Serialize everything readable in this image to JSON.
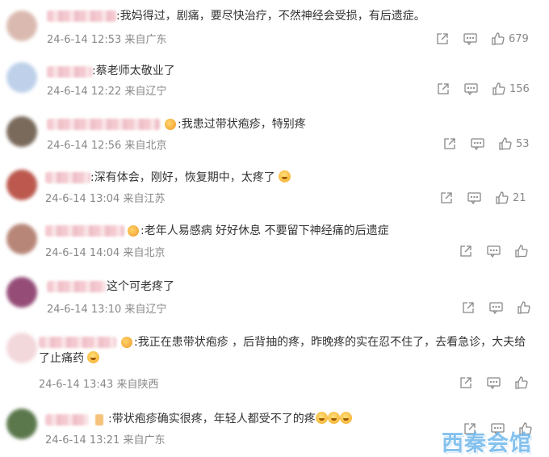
{
  "comments": [
    {
      "text": ":我妈得过，剧痛，要尽快治疗，不然神经会受损，有后遗症。",
      "time": "24-6-14 12:53",
      "location": "来自广东",
      "likes": "679",
      "avatar_color": "#d7b3a8"
    },
    {
      "text": ":蔡老师太敬业了",
      "time": "24-6-14 12:22",
      "location": "来自辽宁",
      "likes": "156",
      "avatar_color": "#b7cce8"
    },
    {
      "text": ":我患过带状疱疹，特别疼",
      "time": "24-6-14 12:56",
      "location": "来自北京",
      "likes": "53",
      "avatar_color": "#6b5a4a"
    },
    {
      "text": ":深有体会，刚好，恢复期中，太疼了",
      "time": "24-6-14 13:04",
      "location": "来自江苏",
      "likes": "21",
      "avatar_color": "#b5473b"
    },
    {
      "text": ":老年人易感病 好好休息 不要留下神经痛的后遗症",
      "time": "24-6-14 14:04",
      "location": "来自北京",
      "likes": "",
      "avatar_color": "#b07a6a"
    },
    {
      "text": "这个可老疼了",
      "time": "24-6-14 13:10",
      "location": "来自辽宁",
      "likes": "",
      "avatar_color": "#8a3a6a"
    },
    {
      "text": ":我正在患带状疱疹 ，后背抽的疼，昨晚疼的实在忍不住了，去看急诊，大夫给了止痛药",
      "time": "24-6-14 13:43",
      "location": "来自陕西",
      "likes": "",
      "avatar_color": "#f2d4d8"
    },
    {
      "text": ":带状疱疹确实很疼，年轻人都受不了的疼",
      "time": "24-6-14 13:21",
      "location": "来自广东",
      "likes": "",
      "avatar_color": "#4a6a3a"
    }
  ],
  "watermark": "西秦会馆",
  "colors": {
    "text": "#333333",
    "meta": "#888888",
    "watermark": "#6fb7ec"
  }
}
